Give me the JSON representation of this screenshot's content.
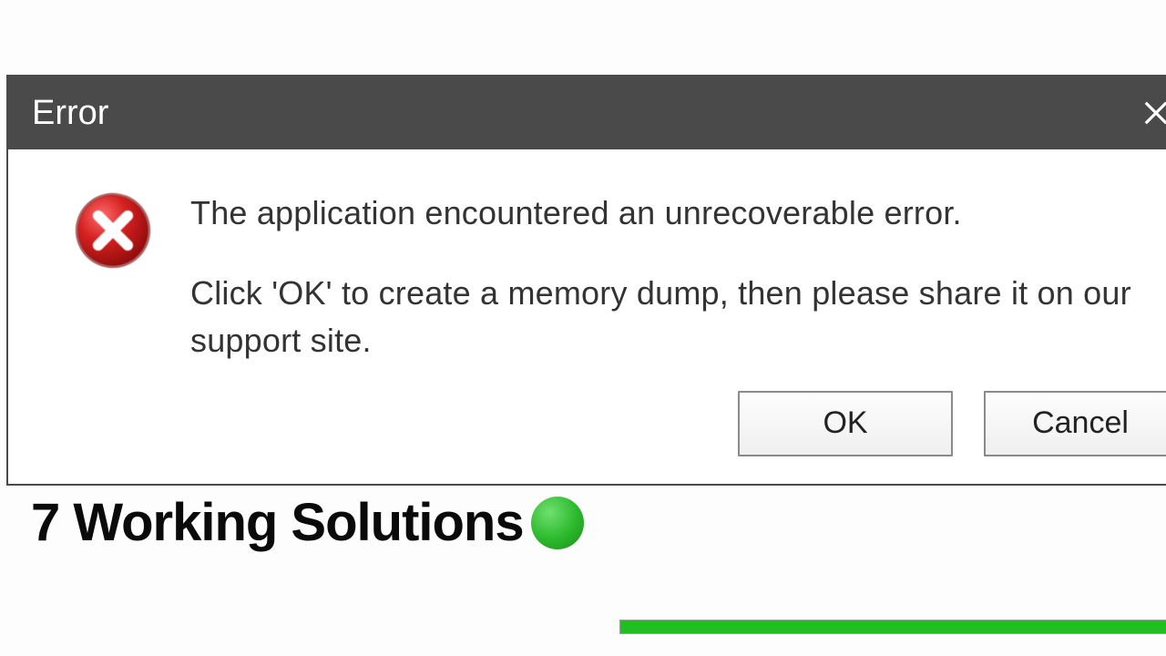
{
  "dialog": {
    "title": "Error",
    "message_line1": "The application encountered an unrecoverable error.",
    "message_line2": "Click 'OK' to create a memory dump, then please share it on our support site.",
    "ok_label": "OK",
    "cancel_label": "Cancel"
  },
  "overlay": {
    "caption": "7 Working Solutions"
  }
}
